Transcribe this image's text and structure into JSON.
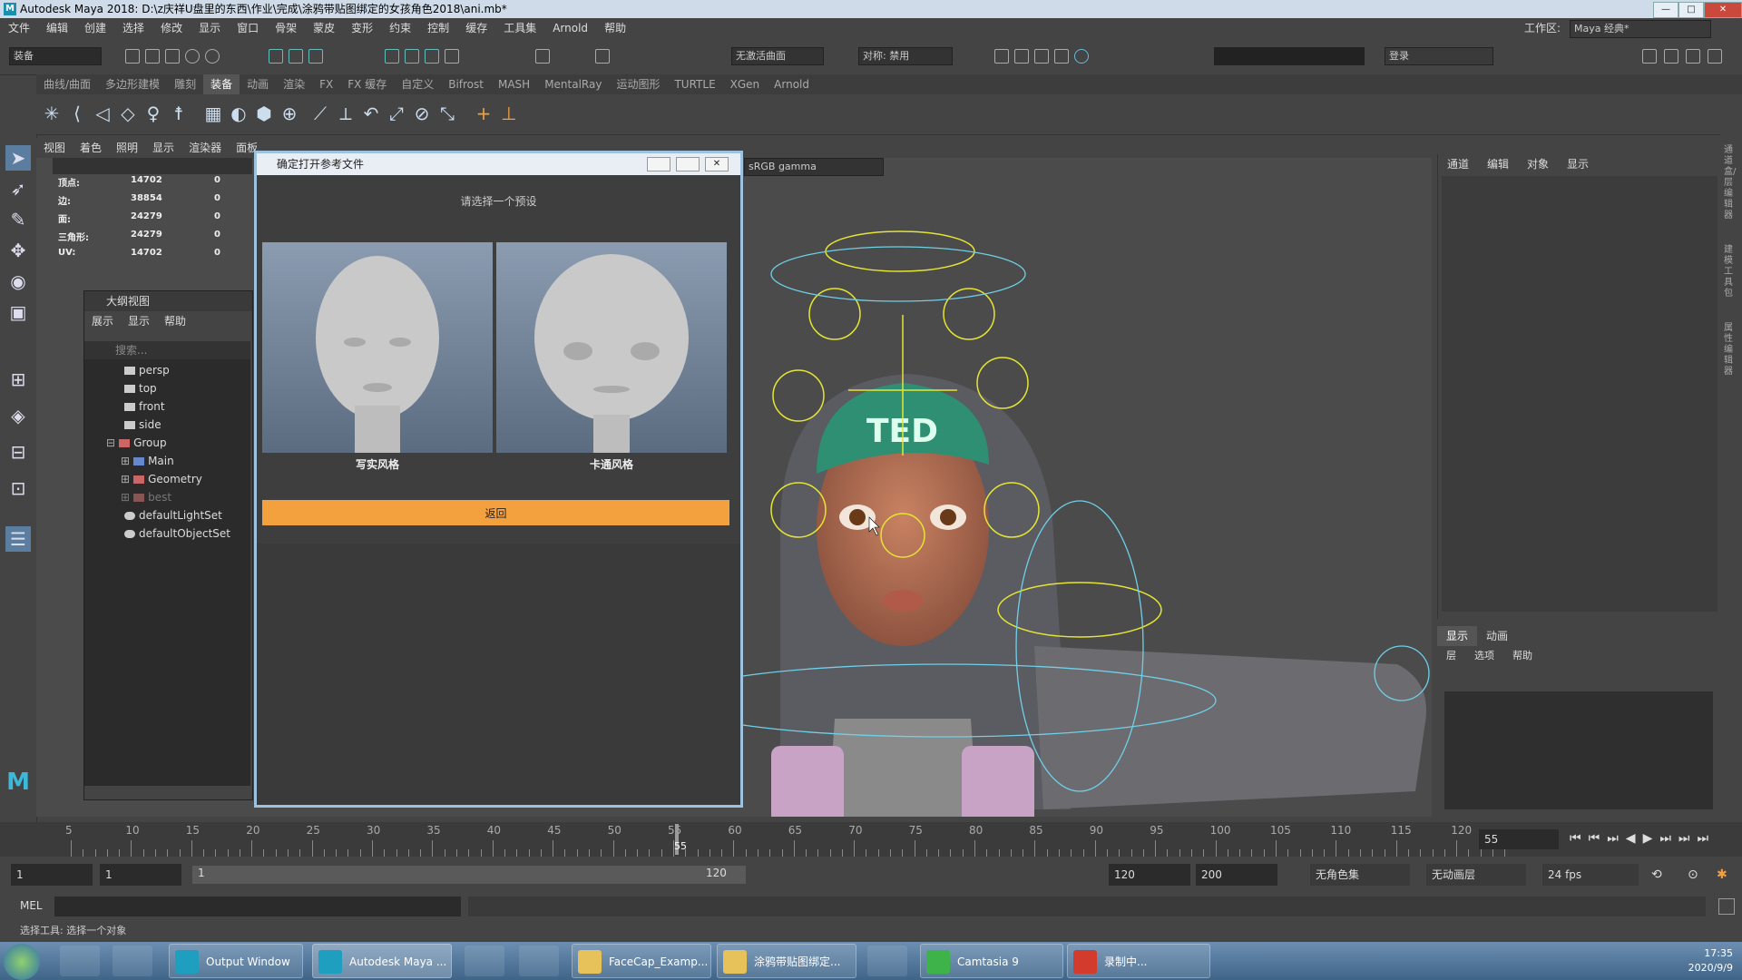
{
  "window": {
    "title": "Autodesk Maya 2018: D:\\z庆祥U盘里的东西\\作业\\完成\\涂鸦带贴图绑定的女孩角色2018\\ani.mb*",
    "logo": "M",
    "minimize": "—",
    "maximize": "□",
    "close": "✕"
  },
  "menubar": [
    "文件",
    "编辑",
    "创建",
    "选择",
    "修改",
    "显示",
    "窗口",
    "骨架",
    "蒙皮",
    "变形",
    "约束",
    "控制",
    "缓存",
    "工具集",
    "Arnold",
    "帮助"
  ],
  "workspace": {
    "label": "工作区:",
    "value": "Maya 经典*"
  },
  "toolbar": {
    "mode": "装备",
    "no_live": "无激活曲面",
    "symmetry": "对称: 禁用",
    "login": "登录"
  },
  "shelf_tabs": [
    "曲线/曲面",
    "多边形建模",
    "雕刻",
    "装备",
    "动画",
    "渲染",
    "FX",
    "FX 缓存",
    "自定义",
    "Bifrost",
    "MASH",
    "MentalRay",
    "运动图形",
    "TURTLE",
    "XGen",
    "Arnold"
  ],
  "shelf_active": "装备",
  "viewport": {
    "menu": [
      "视图",
      "着色",
      "照明",
      "显示",
      "渲染器",
      "面板"
    ],
    "color_mgmt": "sRGB gamma",
    "hud": [
      {
        "label": "顶点:",
        "value": "14702",
        "sel": "0"
      },
      {
        "label": "边:",
        "value": "38854",
        "sel": "0"
      },
      {
        "label": "面:",
        "value": "24279",
        "sel": "0"
      },
      {
        "label": "三角形:",
        "value": "24279",
        "sel": "0"
      },
      {
        "label": "UV:",
        "value": "14702",
        "sel": "0"
      }
    ]
  },
  "outliner": {
    "title": "大纲视图",
    "menu": [
      "展示",
      "显示",
      "帮助"
    ],
    "search_placeholder": "搜索...",
    "items": [
      {
        "label": "persp",
        "kind": "camera",
        "indent": 2
      },
      {
        "label": "top",
        "kind": "camera",
        "indent": 2
      },
      {
        "label": "front",
        "kind": "camera",
        "indent": 2
      },
      {
        "label": "side",
        "kind": "camera",
        "indent": 2
      },
      {
        "label": "Group",
        "kind": "group",
        "indent": 1
      },
      {
        "label": "Main",
        "kind": "joint",
        "indent": 2
      },
      {
        "label": "Geometry",
        "kind": "group",
        "indent": 2
      },
      {
        "label": "best",
        "kind": "group-dim",
        "indent": 2
      },
      {
        "label": "defaultLightSet",
        "kind": "set",
        "indent": 1
      },
      {
        "label": "defaultObjectSet",
        "kind": "set",
        "indent": 1
      }
    ]
  },
  "dialog": {
    "title": "确定打开参考文件",
    "prompt": "请选择一个预设",
    "presets": [
      {
        "label": "写实风格"
      },
      {
        "label": "卡通风格"
      }
    ],
    "back_label": "返回"
  },
  "channel_box": {
    "menu": [
      "通道",
      "编辑",
      "对象",
      "显示"
    ]
  },
  "layer_editor": {
    "tabs": [
      "显示",
      "动画"
    ],
    "menu": [
      "层",
      "选项",
      "帮助"
    ]
  },
  "right_strip_labels": [
    "通道盒/层编辑器",
    "建模工具包",
    "属性编辑器"
  ],
  "timeline": {
    "ticks": [
      "5",
      "10",
      "15",
      "20",
      "25",
      "30",
      "35",
      "40",
      "45",
      "50",
      "55",
      "60",
      "65",
      "70",
      "75",
      "80",
      "85",
      "90",
      "95",
      "100",
      "105",
      "110",
      "115",
      "120"
    ],
    "current": "55",
    "current_field": "55"
  },
  "range": {
    "start": "1",
    "start2": "1",
    "slider_start": "1",
    "slider_end": "120",
    "end": "120",
    "end2": "200",
    "char_set": "无角色集",
    "anim_layer": "无动画层",
    "fps": "24 fps"
  },
  "mel": {
    "label": "MEL"
  },
  "status": "选择工具: 选择一个对象",
  "taskbar": {
    "items": [
      {
        "label": "Output Window",
        "color": "#1f9fbf"
      },
      {
        "label": "Autodesk Maya ...",
        "color": "#1f9fbf"
      },
      {
        "label": "FaceCap_Examp...",
        "color": "#e7c25b"
      },
      {
        "label": "涂鸦带贴图绑定...",
        "color": "#e7c25b"
      },
      {
        "label": "Camtasia 9",
        "color": "#3db34a"
      },
      {
        "label": "录制中...",
        "color": "#d33b2c"
      }
    ],
    "time": "17:35",
    "date": "2020/9/9"
  }
}
